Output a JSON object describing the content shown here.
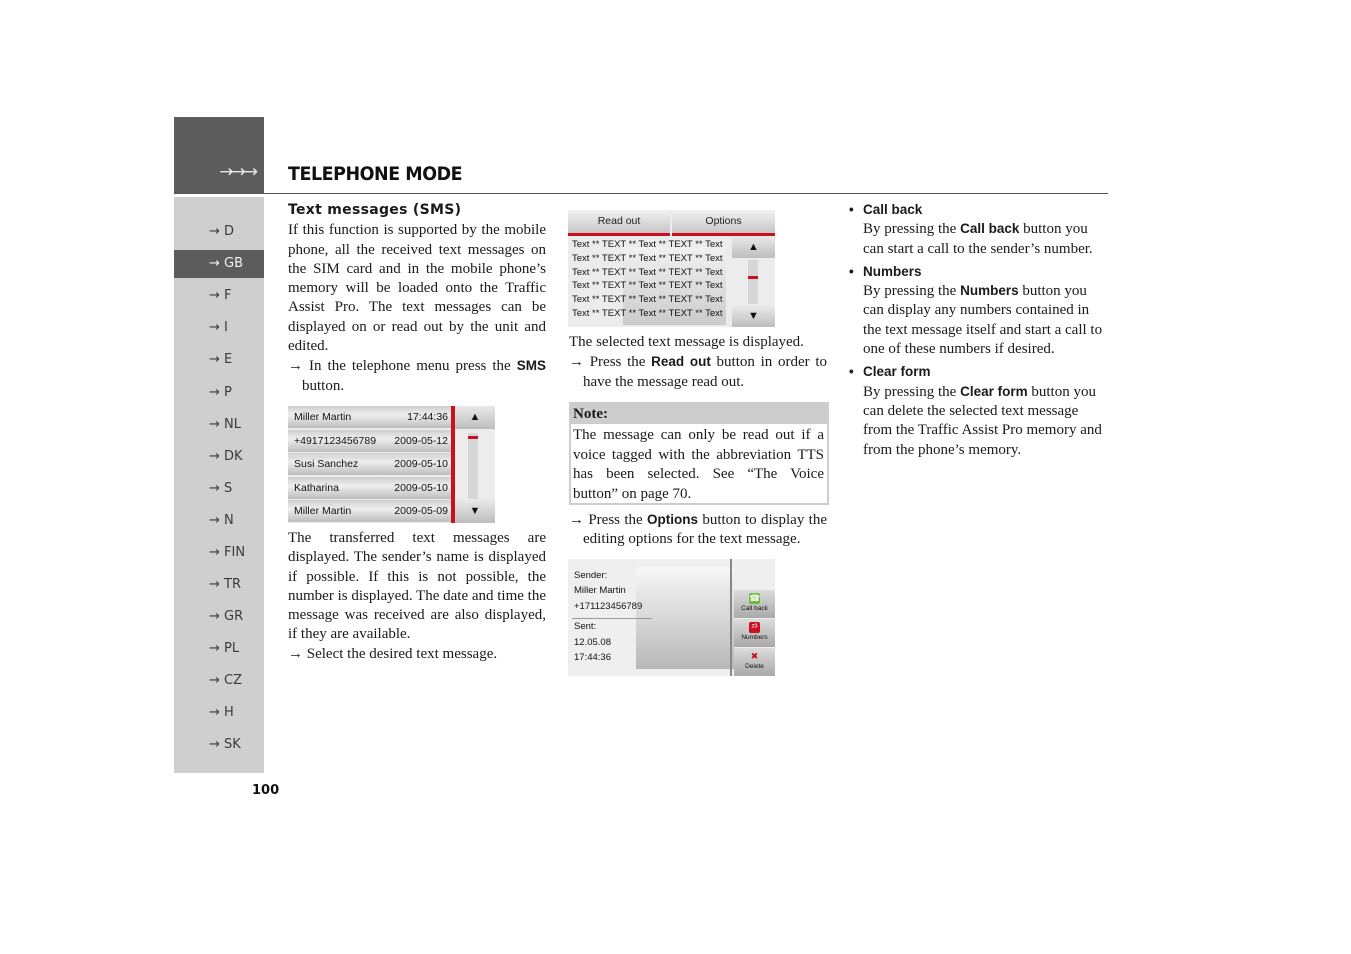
{
  "header": {
    "arrows": "→→→",
    "title": "TELEPHONE MODE"
  },
  "sidebar": {
    "items": [
      {
        "label": "→ D",
        "active": false
      },
      {
        "label": "→ GB",
        "active": true
      },
      {
        "label": "→ F",
        "active": false
      },
      {
        "label": "→ I",
        "active": false
      },
      {
        "label": "→ E",
        "active": false
      },
      {
        "label": "→ P",
        "active": false
      },
      {
        "label": "→ NL",
        "active": false
      },
      {
        "label": "→ DK",
        "active": false
      },
      {
        "label": "→ S",
        "active": false
      },
      {
        "label": "→ N",
        "active": false
      },
      {
        "label": "→ FIN",
        "active": false
      },
      {
        "label": "→ TR",
        "active": false
      },
      {
        "label": "→ GR",
        "active": false
      },
      {
        "label": "→ PL",
        "active": false
      },
      {
        "label": "→ CZ",
        "active": false
      },
      {
        "label": "→ H",
        "active": false
      },
      {
        "label": "→ SK",
        "active": false
      }
    ]
  },
  "page_number": "100",
  "col1": {
    "heading": "Text messages (SMS)",
    "intro": "If this function is supported by the mobile phone, all the received text messages on the SIM card and in the mobile phone’s memory will be loaded onto the Traffic Assist Pro. The text messages can be displayed on or read out by the unit and edited.",
    "step1_pre": "→ In the telephone menu press the ",
    "step1_bold": "SMS",
    "step1_post": " button.",
    "para2": "The transferred text messages are displayed. The sender’s name is displayed if possible. If this is not possible, the number is displayed. The date and time the message was received are also displayed, if they are available.",
    "step2": "→ Select the desired text message."
  },
  "screen_list": {
    "rows": [
      {
        "name": "Miller Martin",
        "date": "17:44:36"
      },
      {
        "name": "+4917123456789",
        "date": "2009-05-12"
      },
      {
        "name": "Susi Sanchez",
        "date": "2009-05-10"
      },
      {
        "name": "Katharina",
        "date": "2009-05-10"
      },
      {
        "name": "Miller Martin",
        "date": "2009-05-09"
      }
    ],
    "up": "▲",
    "down": "▼"
  },
  "screen_message": {
    "read_out": "Read out",
    "options": "Options",
    "lines": [
      "Text ** TEXT ** Text ** TEXT ** Text",
      "Text ** TEXT ** Text ** TEXT ** Text",
      "Text ** TEXT ** Text ** TEXT ** Text",
      "Text ** TEXT ** Text ** TEXT ** Text",
      "Text ** TEXT ** Text ** TEXT ** Text",
      "Text ** TEXT ** Text ** TEXT ** Text"
    ],
    "up": "▲",
    "down": "▼"
  },
  "col2": {
    "para1": "The selected text message is displayed.",
    "step1_pre": "→ Press the ",
    "step1_bold": "Read out",
    "step1_post": " button in order to have the message read out.",
    "note_title": "Note:",
    "note_body": "The message can only be read out if a voice tagged with the abbreviation TTS has been selected. See “The Voice button” on page 70.",
    "step2_pre": "→ Press the ",
    "step2_bold": "Options",
    "step2_post": " button to display the editing options for the text message."
  },
  "screen_detail": {
    "sender_label": "Sender:",
    "sender_name": "Miller Martin",
    "sender_number": "+171123456789",
    "sent_label": "Sent:",
    "sent_date": "12.05.08",
    "sent_time": "17:44:36",
    "buttons": [
      {
        "label": "Call back",
        "icon": "☎"
      },
      {
        "label": "Numbers",
        "icon": "²³"
      },
      {
        "label": "Delete",
        "icon": "✖"
      }
    ]
  },
  "col3": {
    "items": [
      {
        "title": "Call back",
        "pre": "By pressing the ",
        "bold": "Call back",
        "post": " button you can start a call to the sender’s number."
      },
      {
        "title": "Numbers",
        "pre": "By pressing the ",
        "bold": "Numbers",
        "post": " button you can display any numbers contained in the text message itself and start a call to one of these numbers if desired."
      },
      {
        "title": "Clear form",
        "pre": "By pressing the ",
        "bold": "Clear form",
        "post": " button you can delete the selected text message from the Traffic Assist Pro memory and from the phone’s memory."
      }
    ]
  }
}
